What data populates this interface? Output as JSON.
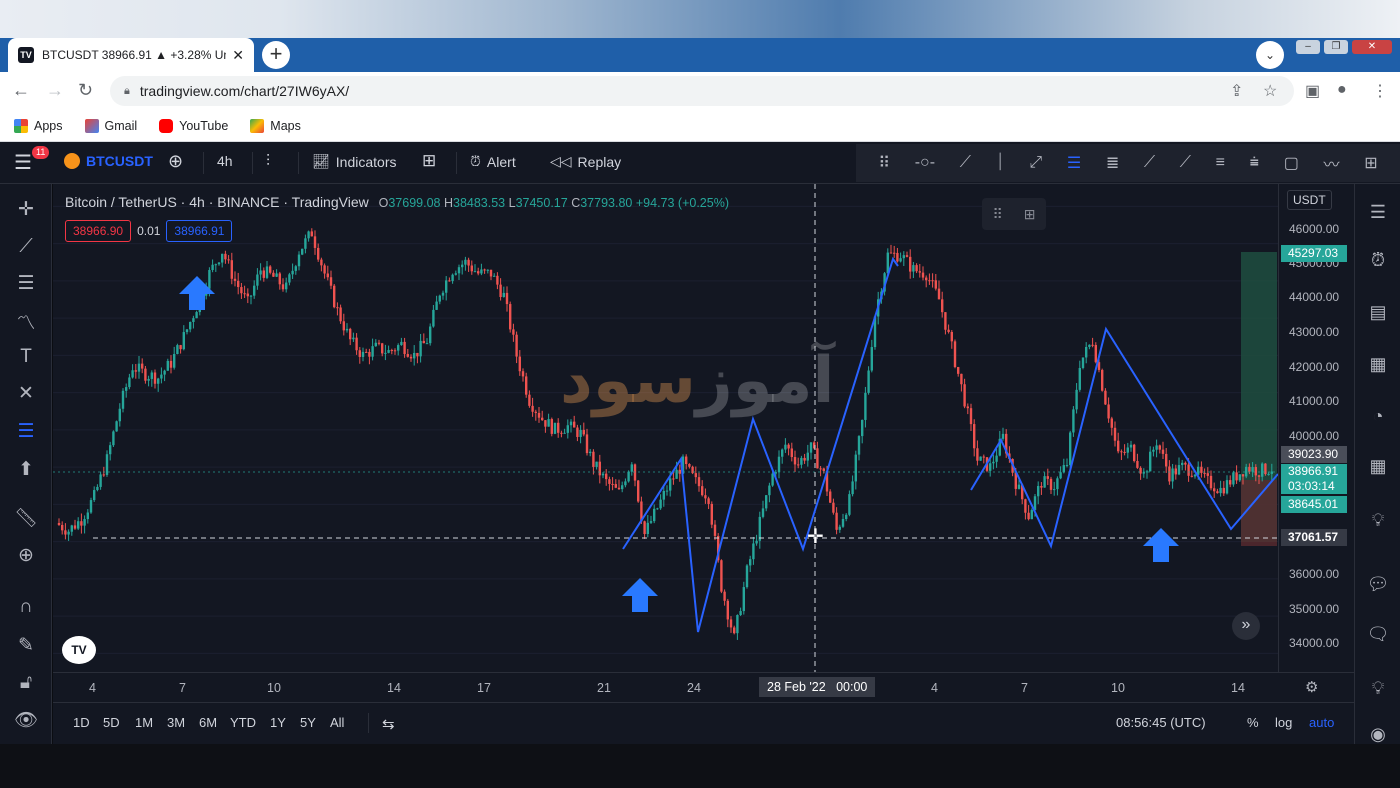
{
  "browser": {
    "tab_title": "BTCUSDT 38966.91 ▲ +3.28% Un",
    "tab_favicon": "TV",
    "url": "tradingview.com/chart/27IW6yAX/",
    "bookmarks": [
      "Apps",
      "Gmail",
      "YouTube",
      "Maps"
    ]
  },
  "toolbar": {
    "badge": "11",
    "symbol": "BTCUSDT",
    "interval": "4h",
    "indicators": "Indicators",
    "alert": "Alert",
    "replay": "Replay"
  },
  "legend": {
    "title": "Bitcoin / TetherUS · 4h · BINANCE · TradingView",
    "o_label": "O",
    "o": "37699.08",
    "h_label": "H",
    "h": "38483.53",
    "l_label": "L",
    "l": "37450.17",
    "c_label": "C",
    "c": "37793.80",
    "change": "+94.73 (+0.25%)",
    "sell": "38966.90",
    "spread": "0.01",
    "buy": "38966.91"
  },
  "price_scale": {
    "currency": "USDT",
    "ticks": [
      "46000.00",
      "45000.00",
      "44000.00",
      "43000.00",
      "42000.00",
      "41000.00",
      "40000.00",
      "36000.00",
      "35000.00",
      "34000.00"
    ],
    "labels": {
      "top_green": "45297.03",
      "gray": "39023.90",
      "current": "38966.91",
      "countdown": "03:03:14",
      "lower_green": "38645.01",
      "cursor": "37061.57"
    }
  },
  "time_scale": {
    "ticks": [
      "4",
      "7",
      "10",
      "14",
      "17",
      "21",
      "24",
      "4",
      "7",
      "10",
      "14"
    ],
    "cursor": "28 Feb '22   00:00"
  },
  "bottom": {
    "ranges": [
      "1D",
      "5D",
      "1M",
      "3M",
      "6M",
      "YTD",
      "1Y",
      "5Y",
      "All"
    ],
    "clock": "08:56:45 (UTC)",
    "pct": "%",
    "log": "log",
    "auto": "auto"
  },
  "watermark": {
    "part1": "سود",
    "part2": "آموز"
  },
  "chart_logo": "TV",
  "colors": {
    "up": "#26a69a",
    "down": "#ef5350",
    "drawing": "#2962ff",
    "bg": "#131722"
  },
  "chart_data": {
    "type": "candlestick",
    "symbol": "BTCUSDT",
    "interval": "4h",
    "ylim": [
      33500,
      46600
    ],
    "x_ticks": [
      "4",
      "7",
      "10",
      "14",
      "17",
      "21",
      "24",
      "28 Feb '22",
      "4",
      "7",
      "10",
      "14"
    ],
    "close_path": [
      37500,
      37300,
      37600,
      38200,
      39200,
      40600,
      41700,
      41500,
      41400,
      41800,
      42500,
      43300,
      44200,
      44800,
      44000,
      43400,
      44300,
      44100,
      43800,
      44800,
      45300,
      44200,
      43200,
      42400,
      42000,
      42200,
      42100,
      42300,
      42000,
      42400,
      43700,
      44300,
      44500,
      44200,
      44200,
      43600,
      42000,
      40800,
      40300,
      40000,
      40100,
      39900,
      39100,
      38600,
      38300,
      39200,
      37200,
      37900,
      38600,
      39100,
      38600,
      38200,
      35800,
      34400,
      36200,
      37500,
      38800,
      39600,
      39100,
      39500,
      38800,
      37300,
      38100,
      40200,
      43100,
      44700,
      44700,
      44300,
      44200,
      43500,
      42200,
      40800,
      39200,
      39000,
      39800,
      38600,
      37700,
      38600,
      38500,
      39100,
      41800,
      42400,
      40800,
      39300,
      39500,
      38800,
      39700,
      38800,
      39000,
      38900,
      38600,
      38400,
      38700,
      39000,
      38900,
      38966.91
    ]
  }
}
